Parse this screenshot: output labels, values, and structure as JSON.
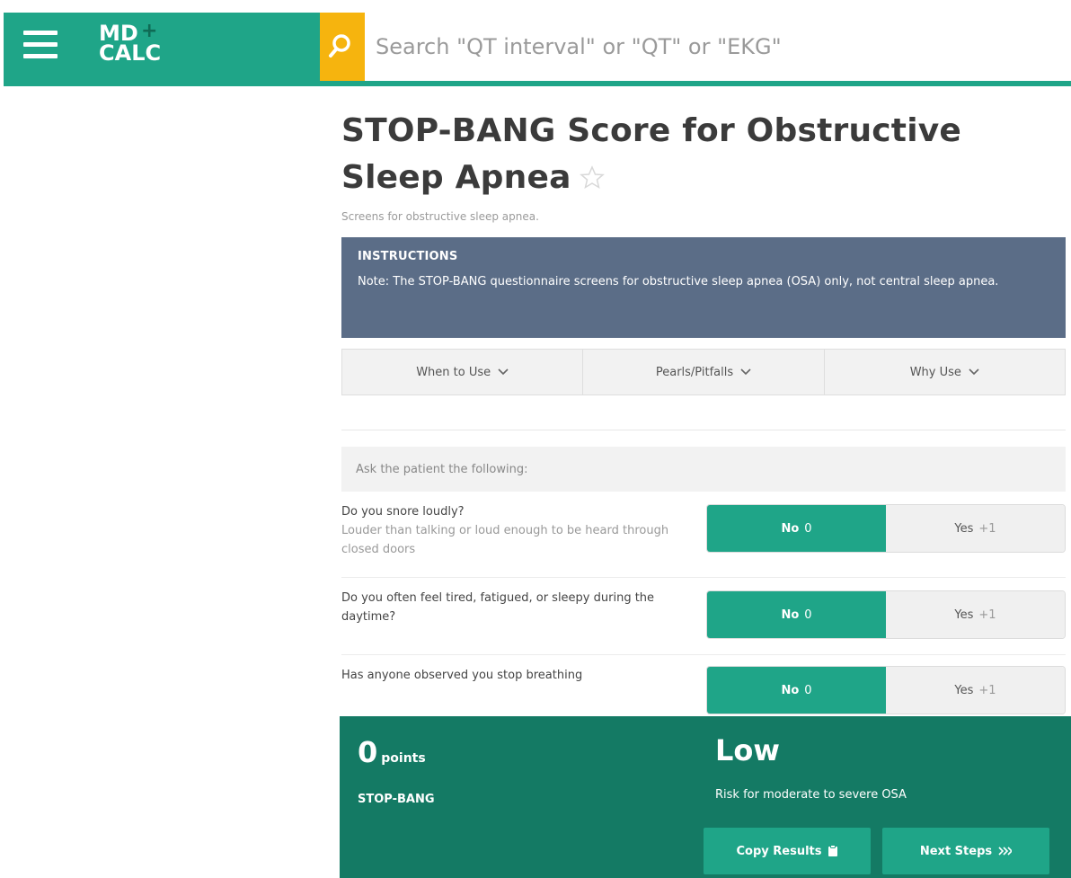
{
  "header": {
    "logo_line1": "MD",
    "logo_line2": "CALC",
    "logo_plus": "+",
    "search_placeholder": "Search \"QT interval\" or \"QT\" or \"EKG\"",
    "menu_icon": "hamburger-icon",
    "search_icon": "search-icon",
    "colors": {
      "brand": "#1fa588",
      "search_accent": "#f6b40e"
    }
  },
  "page": {
    "title": "STOP-BANG Score for Obstructive Sleep Apnea",
    "subtitle": "Screens for obstructive sleep apnea."
  },
  "instructions": {
    "label": "INSTRUCTIONS",
    "note": "Note: The STOP-BANG questionnaire screens for obstructive sleep apnea (OSA) only, not central sleep apnea.",
    "color": "#5b6d87"
  },
  "tabs": [
    {
      "label": "When to Use"
    },
    {
      "label": "Pearls/Pitfalls"
    },
    {
      "label": "Why Use"
    }
  ],
  "ask_prompt": "Ask the patient the following:",
  "questions": [
    {
      "text": "Do you snore loudly?",
      "sub": "Louder than talking or loud enough to be heard through closed doors",
      "no_label": "No",
      "no_points": "0",
      "yes_label": "Yes",
      "yes_points": "+1",
      "selected": "No"
    },
    {
      "text": "Do you often feel tired, fatigued, or sleepy during the daytime?",
      "sub": "",
      "no_label": "No",
      "no_points": "0",
      "yes_label": "Yes",
      "yes_points": "+1",
      "selected": "No"
    },
    {
      "text": "Has anyone observed you stop breathing",
      "sub": "",
      "no_label": "No",
      "no_points": "0",
      "yes_label": "Yes",
      "yes_points": "+1",
      "selected": "No"
    }
  ],
  "result": {
    "score": "0",
    "score_unit": "points",
    "score_name": "STOP-BANG",
    "risk": "Low",
    "risk_desc": "Risk for moderate to severe OSA",
    "copy_label": "Copy Results",
    "next_label": "Next Steps",
    "color": "#147a64"
  }
}
